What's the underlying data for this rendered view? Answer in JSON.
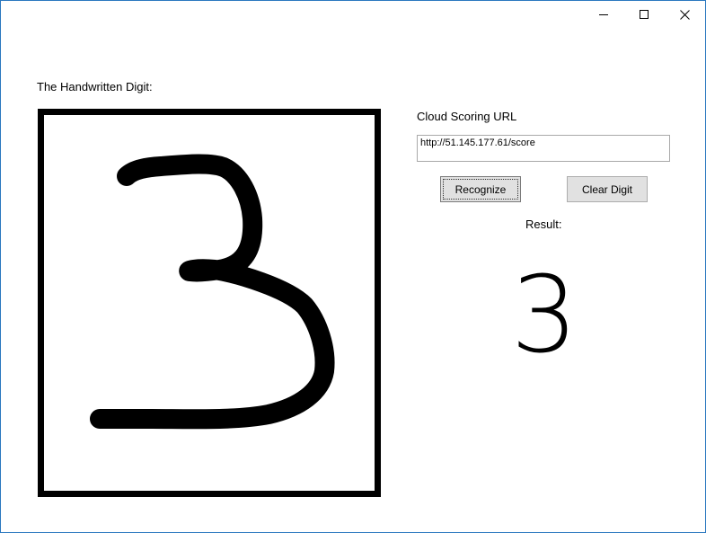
{
  "window": {
    "controls": {
      "minimize_icon": "minimize-icon",
      "maximize_icon": "maximize-icon",
      "close_icon": "close-icon"
    }
  },
  "canvas": {
    "label": "The Handwritten Digit:",
    "drawn_digit": "3"
  },
  "scoring": {
    "label": "Cloud Scoring URL",
    "url_value": "http://51.145.177.61/score"
  },
  "buttons": {
    "recognize_label": "Recognize",
    "clear_label": "Clear Digit"
  },
  "result": {
    "label": "Result:",
    "value": "3"
  }
}
